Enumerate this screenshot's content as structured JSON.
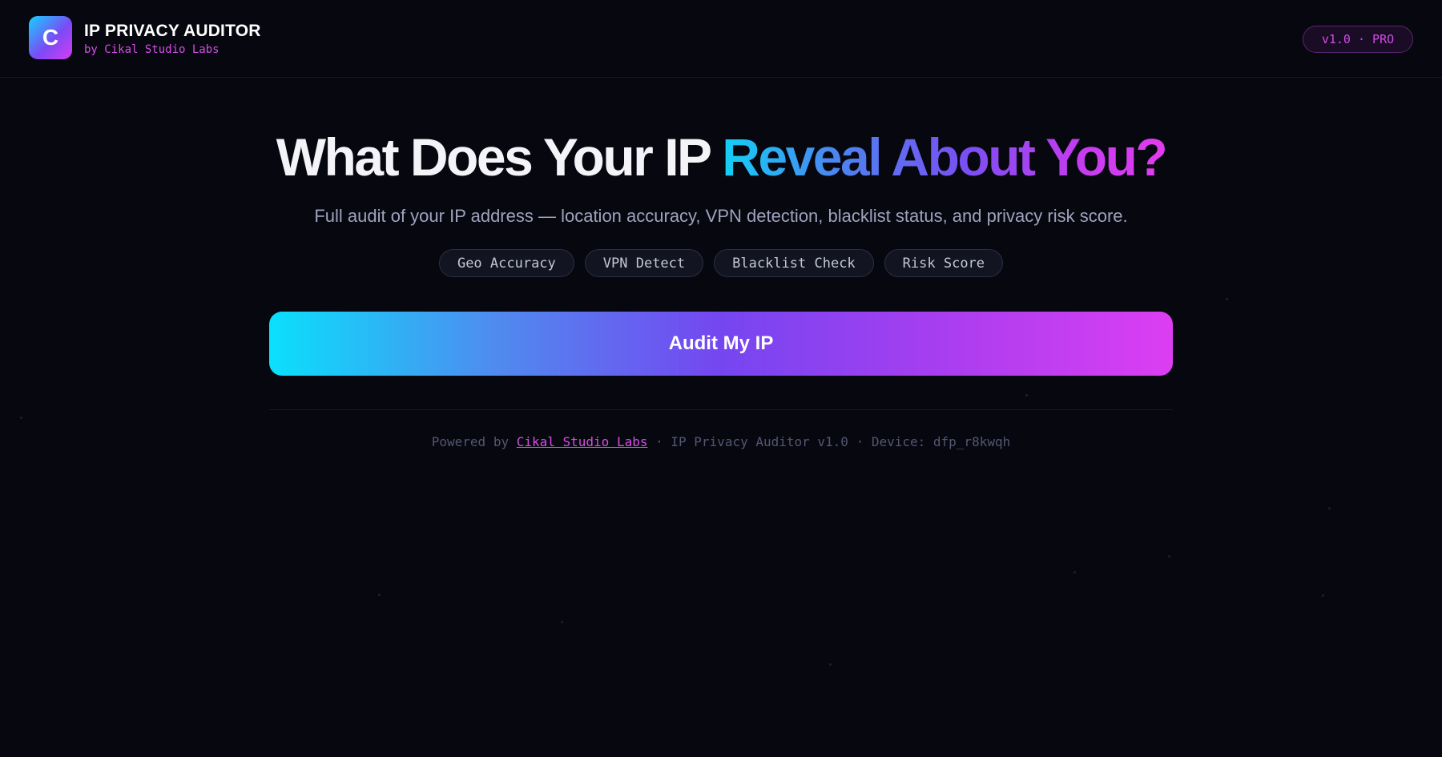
{
  "header": {
    "logo_letter": "C",
    "title": "IP PRIVACY AUDITOR",
    "subtitle": "by Cikal Studio Labs",
    "version_badge": "v1.0 · PRO"
  },
  "hero": {
    "title_plain": "What Does Your IP ",
    "title_gradient": "Reveal About You?",
    "subtitle": "Full audit of your IP address — location accuracy, VPN detection, blacklist status, and privacy risk score.",
    "chips": [
      "Geo Accuracy",
      "VPN Detect",
      "Blacklist Check",
      "Risk Score"
    ]
  },
  "action": {
    "audit_label": "Audit My IP"
  },
  "footer": {
    "prefix": "Powered by ",
    "link_text": "Cikal Studio Labs",
    "suffix": " · IP Privacy Auditor v1.0 · Device: dfp_r8kwqh"
  },
  "colors": {
    "background": "#07070f",
    "accent_cyan": "#0ae0fc",
    "accent_purple": "#7546f0",
    "accent_magenta": "#dc3ef2",
    "muted_text": "#9ea3bd"
  }
}
